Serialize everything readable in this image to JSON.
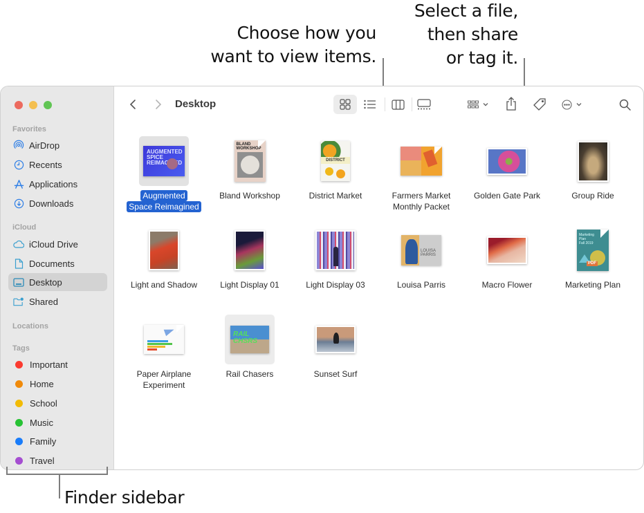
{
  "callouts": {
    "view": [
      "Choose how you",
      "want to view items."
    ],
    "share": [
      "Select a file,",
      "then share",
      "or tag it."
    ],
    "sidebar": "Finder sidebar"
  },
  "window": {
    "title": "Desktop",
    "traffic_lights": {
      "close": "#ec6a5e",
      "minimize": "#f4bf4f",
      "zoom": "#61c554"
    }
  },
  "sidebar": {
    "sections": {
      "favorites": "Favorites",
      "icloud": "iCloud",
      "locations": "Locations",
      "tags": "Tags"
    },
    "favorites": [
      {
        "label": "AirDrop",
        "icon": "airdrop-icon"
      },
      {
        "label": "Recents",
        "icon": "clock-icon"
      },
      {
        "label": "Applications",
        "icon": "applications-icon"
      },
      {
        "label": "Downloads",
        "icon": "download-icon"
      }
    ],
    "icloud": [
      {
        "label": "iCloud Drive",
        "icon": "cloud-icon"
      },
      {
        "label": "Documents",
        "icon": "document-icon"
      },
      {
        "label": "Desktop",
        "icon": "desktop-icon",
        "selected": true
      },
      {
        "label": "Shared",
        "icon": "shared-folder-icon"
      }
    ],
    "tags": [
      {
        "label": "Important",
        "color": "#fb3b30"
      },
      {
        "label": "Home",
        "color": "#f08a0a"
      },
      {
        "label": "School",
        "color": "#f2bb06"
      },
      {
        "label": "Music",
        "color": "#27c234"
      },
      {
        "label": "Family",
        "color": "#1a7dfa"
      },
      {
        "label": "Travel",
        "color": "#a54ed1"
      }
    ]
  },
  "toolbar": {
    "back": "back-chevron-icon",
    "forward": "forward-chevron-icon",
    "view_modes": [
      "icon-view",
      "list-view",
      "column-view",
      "gallery-view"
    ],
    "active_view": "icon-view",
    "group": "group-by-icon",
    "share": "share-icon",
    "tag": "tag-icon",
    "more": "more-actions-icon",
    "search": "search-icon"
  },
  "files": [
    {
      "name": [
        "Augmented",
        "Space Reimagined"
      ],
      "selected": true
    },
    {
      "name": [
        "Bland Workshop"
      ]
    },
    {
      "name": [
        "District Market"
      ]
    },
    {
      "name": [
        "Farmers Market",
        "Monthly Packet"
      ]
    },
    {
      "name": [
        "Golden Gate Park"
      ]
    },
    {
      "name": [
        "Group Ride"
      ]
    },
    {
      "name": [
        "Light and Shadow"
      ]
    },
    {
      "name": [
        "Light Display 01"
      ]
    },
    {
      "name": [
        "Light Display 03"
      ]
    },
    {
      "name": [
        "Louisa Parris"
      ]
    },
    {
      "name": [
        "Macro Flower"
      ]
    },
    {
      "name": [
        "Marketing Plan"
      ]
    },
    {
      "name": [
        "Paper Airplane",
        "Experiment"
      ]
    },
    {
      "name": [
        "Rail Chasers"
      ]
    },
    {
      "name": [
        "Sunset Surf"
      ]
    }
  ]
}
